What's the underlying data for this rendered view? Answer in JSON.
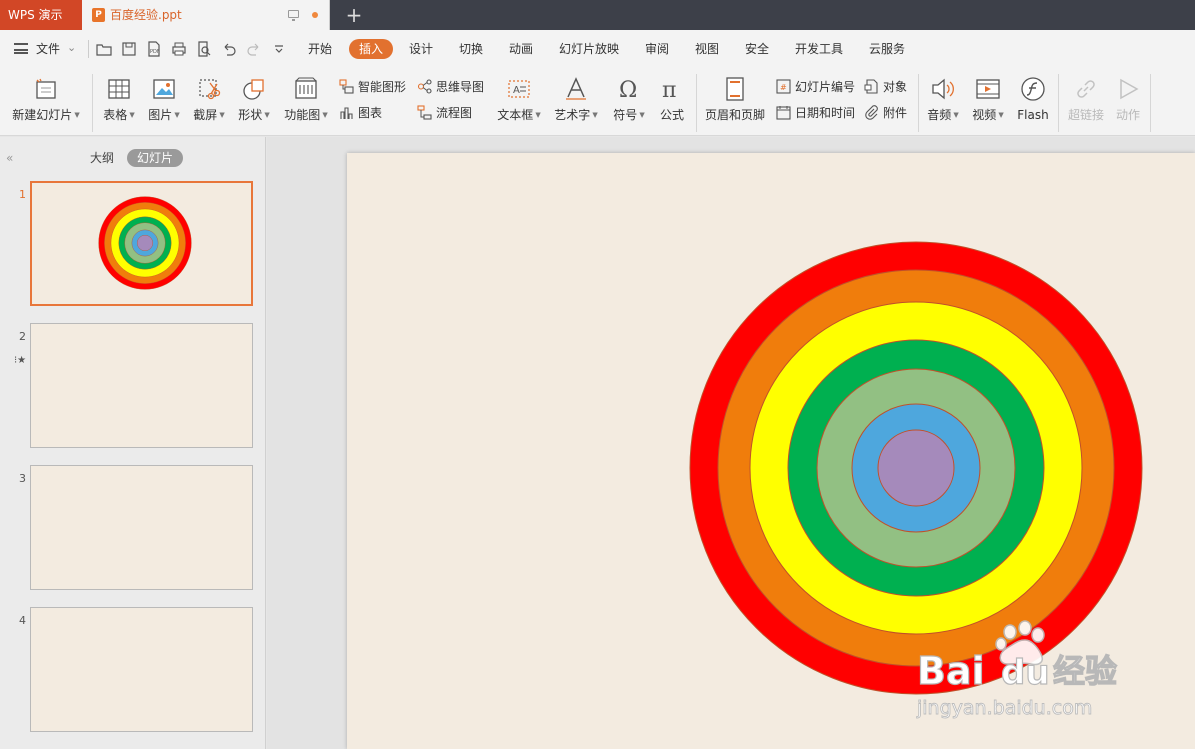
{
  "titlebar": {
    "app_tab": "WPS 演示",
    "doc_tab": "百度经验.ppt",
    "doc_icon_letter": "P",
    "new_tab": "+"
  },
  "menubar": {
    "file_label": "文件",
    "tabs": [
      "开始",
      "插入",
      "设计",
      "切换",
      "动画",
      "幻灯片放映",
      "审阅",
      "视图",
      "安全",
      "开发工具",
      "云服务"
    ],
    "active_tab": "插入",
    "accent_color": "#e2712f"
  },
  "ribbon": {
    "new_slide": "新建幻灯片",
    "table": "表格",
    "picture": "图片",
    "screenshot": "截屏",
    "shape": "形状",
    "function_chart": "功能图",
    "smart_art": "智能图形",
    "chart": "图表",
    "mind_map": "思维导图",
    "flowchart": "流程图",
    "text_box": "文本框",
    "word_art": "艺术字",
    "symbol": "符号",
    "formula": "公式",
    "header_footer": "页眉和页脚",
    "slide_number": "幻灯片编号",
    "date_time": "日期和时间",
    "object": "对象",
    "attachment": "附件",
    "audio": "音频",
    "video": "视频",
    "flash": "Flash",
    "hyperlink": "超链接",
    "action": "动作"
  },
  "left_panel": {
    "outline_tab": "大纲",
    "slides_tab": "幻灯片",
    "slides": [
      {
        "number": "1",
        "selected": true
      },
      {
        "number": "2",
        "selected": false,
        "has_animation": true
      },
      {
        "number": "3",
        "selected": false
      },
      {
        "number": "4",
        "selected": false
      }
    ]
  },
  "slide": {
    "background": "#f3ebe0",
    "rings": [
      {
        "color": "#ff0000"
      },
      {
        "color": "#f07d0c"
      },
      {
        "color": "#ffff00"
      },
      {
        "color": "#00b050"
      },
      {
        "color": "#92c083"
      },
      {
        "color": "#4ea7dd"
      },
      {
        "color": "#a58abb"
      }
    ]
  },
  "watermark": {
    "logo_text_left": "Bai",
    "logo_text_right": "经验",
    "url": "jingyan.baidu.com"
  }
}
